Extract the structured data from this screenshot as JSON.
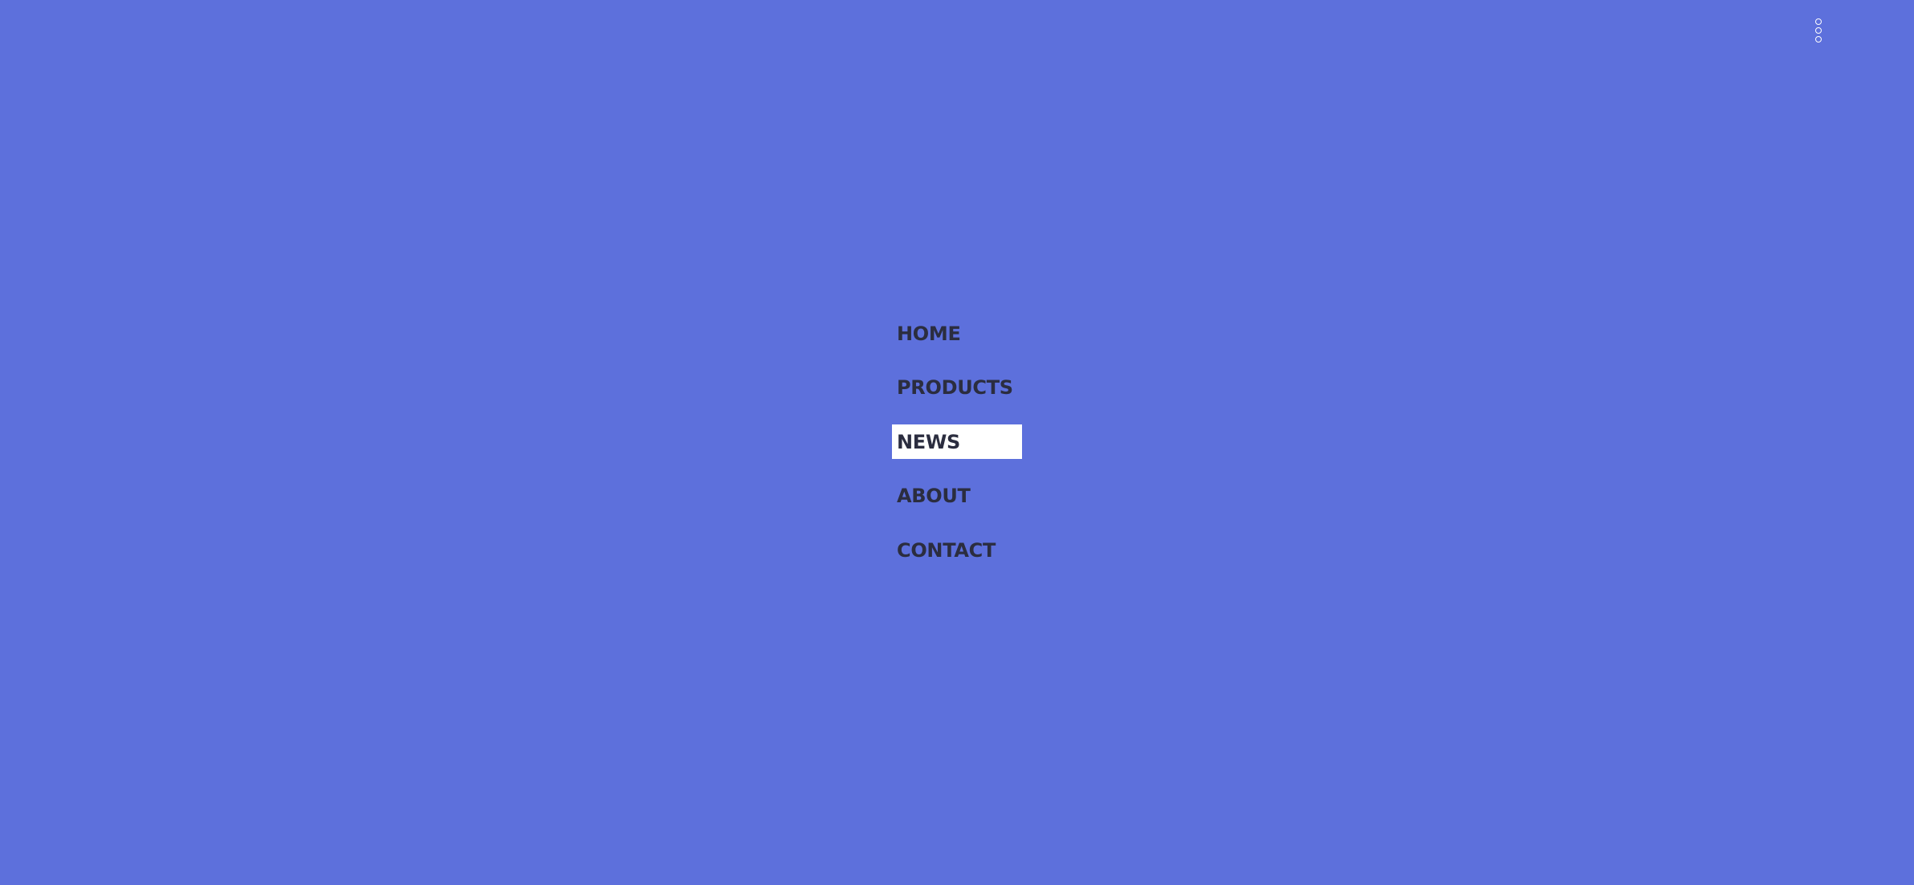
{
  "theme": {
    "background": "#5d70dc",
    "text": "#2b2d3f",
    "highlight": "#ffffff"
  },
  "header": {
    "menu_icon": "more-vertical-icon"
  },
  "nav": {
    "items": [
      {
        "label": "HOME",
        "active": false
      },
      {
        "label": "PRODUCTS",
        "active": false
      },
      {
        "label": "NEWS",
        "active": true
      },
      {
        "label": "ABOUT",
        "active": false
      },
      {
        "label": "CONTACT",
        "active": false
      }
    ]
  }
}
